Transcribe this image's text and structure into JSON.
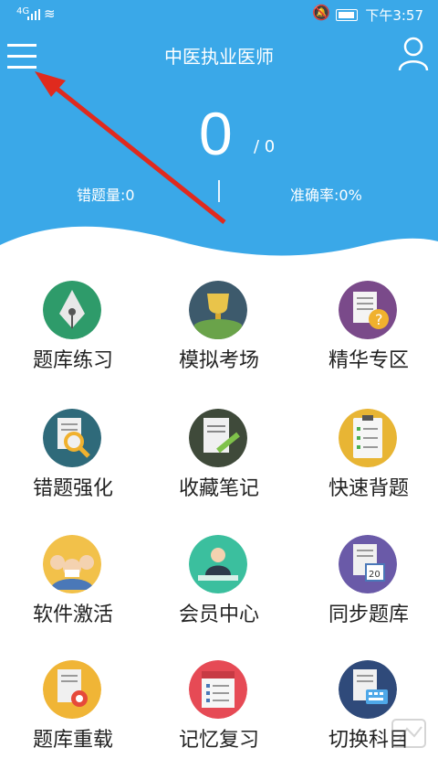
{
  "status_bar": {
    "network": "4G",
    "time": "下午3:57"
  },
  "header": {
    "title": "中医执业医师",
    "score": "0",
    "total": "/ 0",
    "wrong_count": "错题量:0",
    "accuracy": "准确率:0%"
  },
  "grid": [
    {
      "label": "题库练习",
      "icon": "pen-nib-icon",
      "color": "#2e9b6a"
    },
    {
      "label": "模拟考场",
      "icon": "trophy-icon",
      "color": "#3d5a6c"
    },
    {
      "label": "精华专区",
      "icon": "question-doc-icon",
      "color": "#7a4a8a"
    },
    {
      "label": "错题强化",
      "icon": "magnifier-doc-icon",
      "color": "#2f6a7a"
    },
    {
      "label": "收藏笔记",
      "icon": "note-pen-icon",
      "color": "#3f4a3a"
    },
    {
      "label": "快速背题",
      "icon": "clipboard-checklist-icon",
      "color": "#e8b534"
    },
    {
      "label": "软件激活",
      "icon": "people-group-icon",
      "color": "#f2c14a"
    },
    {
      "label": "会员中心",
      "icon": "person-desk-icon",
      "color": "#3bbf9e"
    },
    {
      "label": "同步题库",
      "icon": "calendar-doc-icon",
      "color": "#6a5aa8"
    },
    {
      "label": "题库重载",
      "icon": "doc-target-icon",
      "color": "#f0b536"
    },
    {
      "label": "记忆复习",
      "icon": "calendar-list-icon",
      "color": "#e64a55"
    },
    {
      "label": "切换科目",
      "icon": "doc-keyboard-icon",
      "color": "#2f4a7a"
    }
  ]
}
